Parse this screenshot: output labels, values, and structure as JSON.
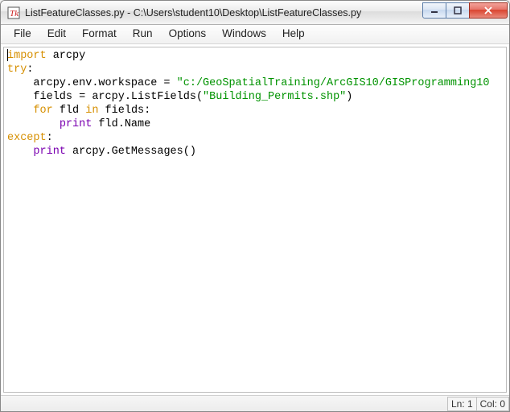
{
  "window": {
    "title": "ListFeatureClasses.py - C:\\Users\\student10\\Desktop\\ListFeatureClasses.py"
  },
  "menu": {
    "file": "File",
    "edit": "Edit",
    "format": "Format",
    "run": "Run",
    "options": "Options",
    "windows": "Windows",
    "help": "Help"
  },
  "code": {
    "l1_import": "import",
    "l1_rest": " arcpy",
    "l2_try": "try",
    "l2_colon": ":",
    "l3_indent": "    arcpy.env.workspace = ",
    "l3_str": "\"c:/GeoSpatialTraining/ArcGIS10/GISProgramming10",
    "l4_indent": "    fields = arcpy.ListFields(",
    "l4_str": "\"Building_Permits.shp\"",
    "l4_close": ")",
    "l5_indent": "    ",
    "l5_for": "for",
    "l5_mid": " fld ",
    "l5_in": "in",
    "l5_rest": " fields:",
    "l6_indent": "        ",
    "l6_print": "print",
    "l6_rest": " fld.Name",
    "l7_except": "except",
    "l7_colon": ":",
    "l8_indent": "    ",
    "l8_print": "print",
    "l8_rest": " arcpy.GetMessages()"
  },
  "status": {
    "line": "Ln: 1",
    "col": "Col: 0"
  }
}
